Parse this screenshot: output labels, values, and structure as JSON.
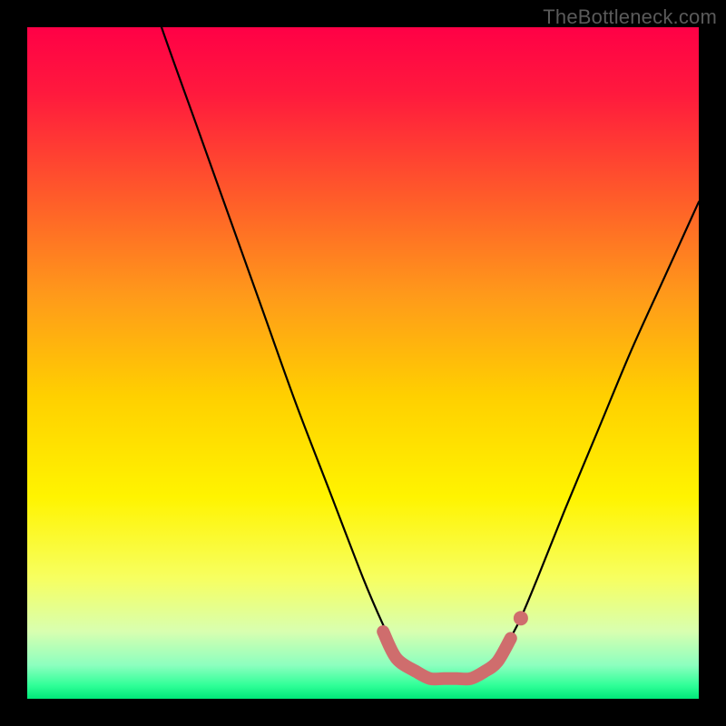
{
  "watermark": "TheBottleneck.com",
  "chart_data": {
    "type": "line",
    "title": "",
    "xlabel": "",
    "ylabel": "",
    "xlim": [
      0,
      100
    ],
    "ylim": [
      0,
      100
    ],
    "series": [
      {
        "name": "bottleneck-curve",
        "x": [
          0,
          5,
          10,
          15,
          20,
          25,
          30,
          35,
          40,
          45,
          50,
          53,
          55,
          58,
          60,
          62,
          64,
          66,
          68,
          70,
          73,
          76,
          80,
          85,
          90,
          95,
          100
        ],
        "y": [
          160,
          145,
          130,
          115,
          100,
          86,
          72,
          58,
          44,
          31,
          18,
          11,
          7,
          4,
          3,
          3,
          3,
          3,
          4,
          6,
          11,
          18,
          28,
          40,
          52,
          63,
          74
        ]
      },
      {
        "name": "highlight-segment",
        "x": [
          53,
          55,
          58,
          60,
          62,
          64,
          66,
          68,
          70,
          72
        ],
        "y": [
          10,
          6,
          4,
          3,
          3,
          3,
          3,
          4,
          5.5,
          9
        ]
      }
    ],
    "gradient_stops": [
      {
        "pct": 0,
        "color": "#ff0046"
      },
      {
        "pct": 10,
        "color": "#ff1a3d"
      },
      {
        "pct": 25,
        "color": "#ff5a2a"
      },
      {
        "pct": 40,
        "color": "#ff9a1a"
      },
      {
        "pct": 55,
        "color": "#ffd000"
      },
      {
        "pct": 70,
        "color": "#fff400"
      },
      {
        "pct": 82,
        "color": "#f7ff60"
      },
      {
        "pct": 90,
        "color": "#d8ffb0"
      },
      {
        "pct": 95,
        "color": "#8cffbf"
      },
      {
        "pct": 98,
        "color": "#30ff98"
      },
      {
        "pct": 100,
        "color": "#00e878"
      }
    ],
    "curve_color": "#000000",
    "highlight_color": "#cf6d6d"
  }
}
